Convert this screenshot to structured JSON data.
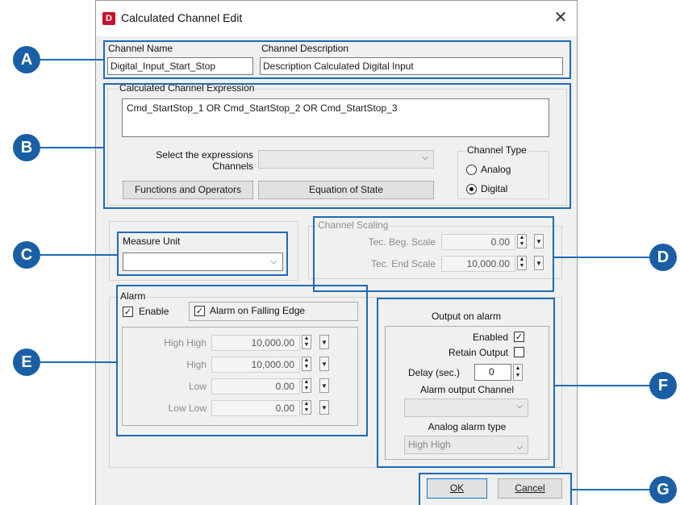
{
  "window": {
    "title": "Calculated Channel Edit",
    "app_icon": "D",
    "close_glyph": "✕"
  },
  "channel": {
    "name_label": "Channel Name",
    "name_value": "Digital_Input_Start_Stop",
    "desc_label": "Channel Description",
    "desc_value": "Description Calculated Digital Input"
  },
  "expression": {
    "group_label": "Calculated Channel Expression",
    "value": "Cmd_StartStop_1 OR Cmd_StartStop_2 OR Cmd_StartStop_3",
    "select_label_1": "Select the expressions",
    "select_label_2": "Channels",
    "select_value": "",
    "functions_button": "Functions and Operators",
    "equation_button": "Equation of State"
  },
  "channel_type": {
    "label": "Channel Type",
    "analog": "Analog",
    "digital": "Digital",
    "selected": "Digital"
  },
  "measure_unit": {
    "label": "Measure Unit",
    "value": ""
  },
  "scaling": {
    "label": "Channel Scaling",
    "beg_label": "Tec. Beg. Scale",
    "beg_value": "0.00",
    "end_label": "Tec. End Scale",
    "end_value": "10,000.00"
  },
  "alarm": {
    "label": "Alarm",
    "enable_label": "Enable",
    "enable_checked": true,
    "falling_label": "Alarm on Falling Edge",
    "falling_checked": true,
    "rows": [
      {
        "label": "High High",
        "value": "10,000.00"
      },
      {
        "label": "High",
        "value": "10,000.00"
      },
      {
        "label": "Low",
        "value": "0.00"
      },
      {
        "label": "Low Low",
        "value": "0.00"
      }
    ]
  },
  "output": {
    "title": "Output on alarm",
    "enabled_label": "Enabled",
    "enabled_checked": true,
    "retain_label": "Retain Output",
    "retain_checked": false,
    "delay_label": "Delay (sec.)",
    "delay_value": "0",
    "channel_label": "Alarm output Channel",
    "channel_value": "",
    "type_label": "Analog alarm type",
    "type_value": "High High"
  },
  "buttons": {
    "ok": "OK",
    "cancel": "Cancel"
  },
  "callouts": [
    "A",
    "B",
    "C",
    "D",
    "E",
    "F",
    "G"
  ],
  "colors": {
    "callout_blue": "#1a5fa6",
    "app_icon_red": "#c8102e"
  },
  "icons": {
    "dropdown": "chevron-down-icon",
    "spin": "spin-updown-icon",
    "check": "checkmark-icon",
    "close": "close-icon"
  }
}
